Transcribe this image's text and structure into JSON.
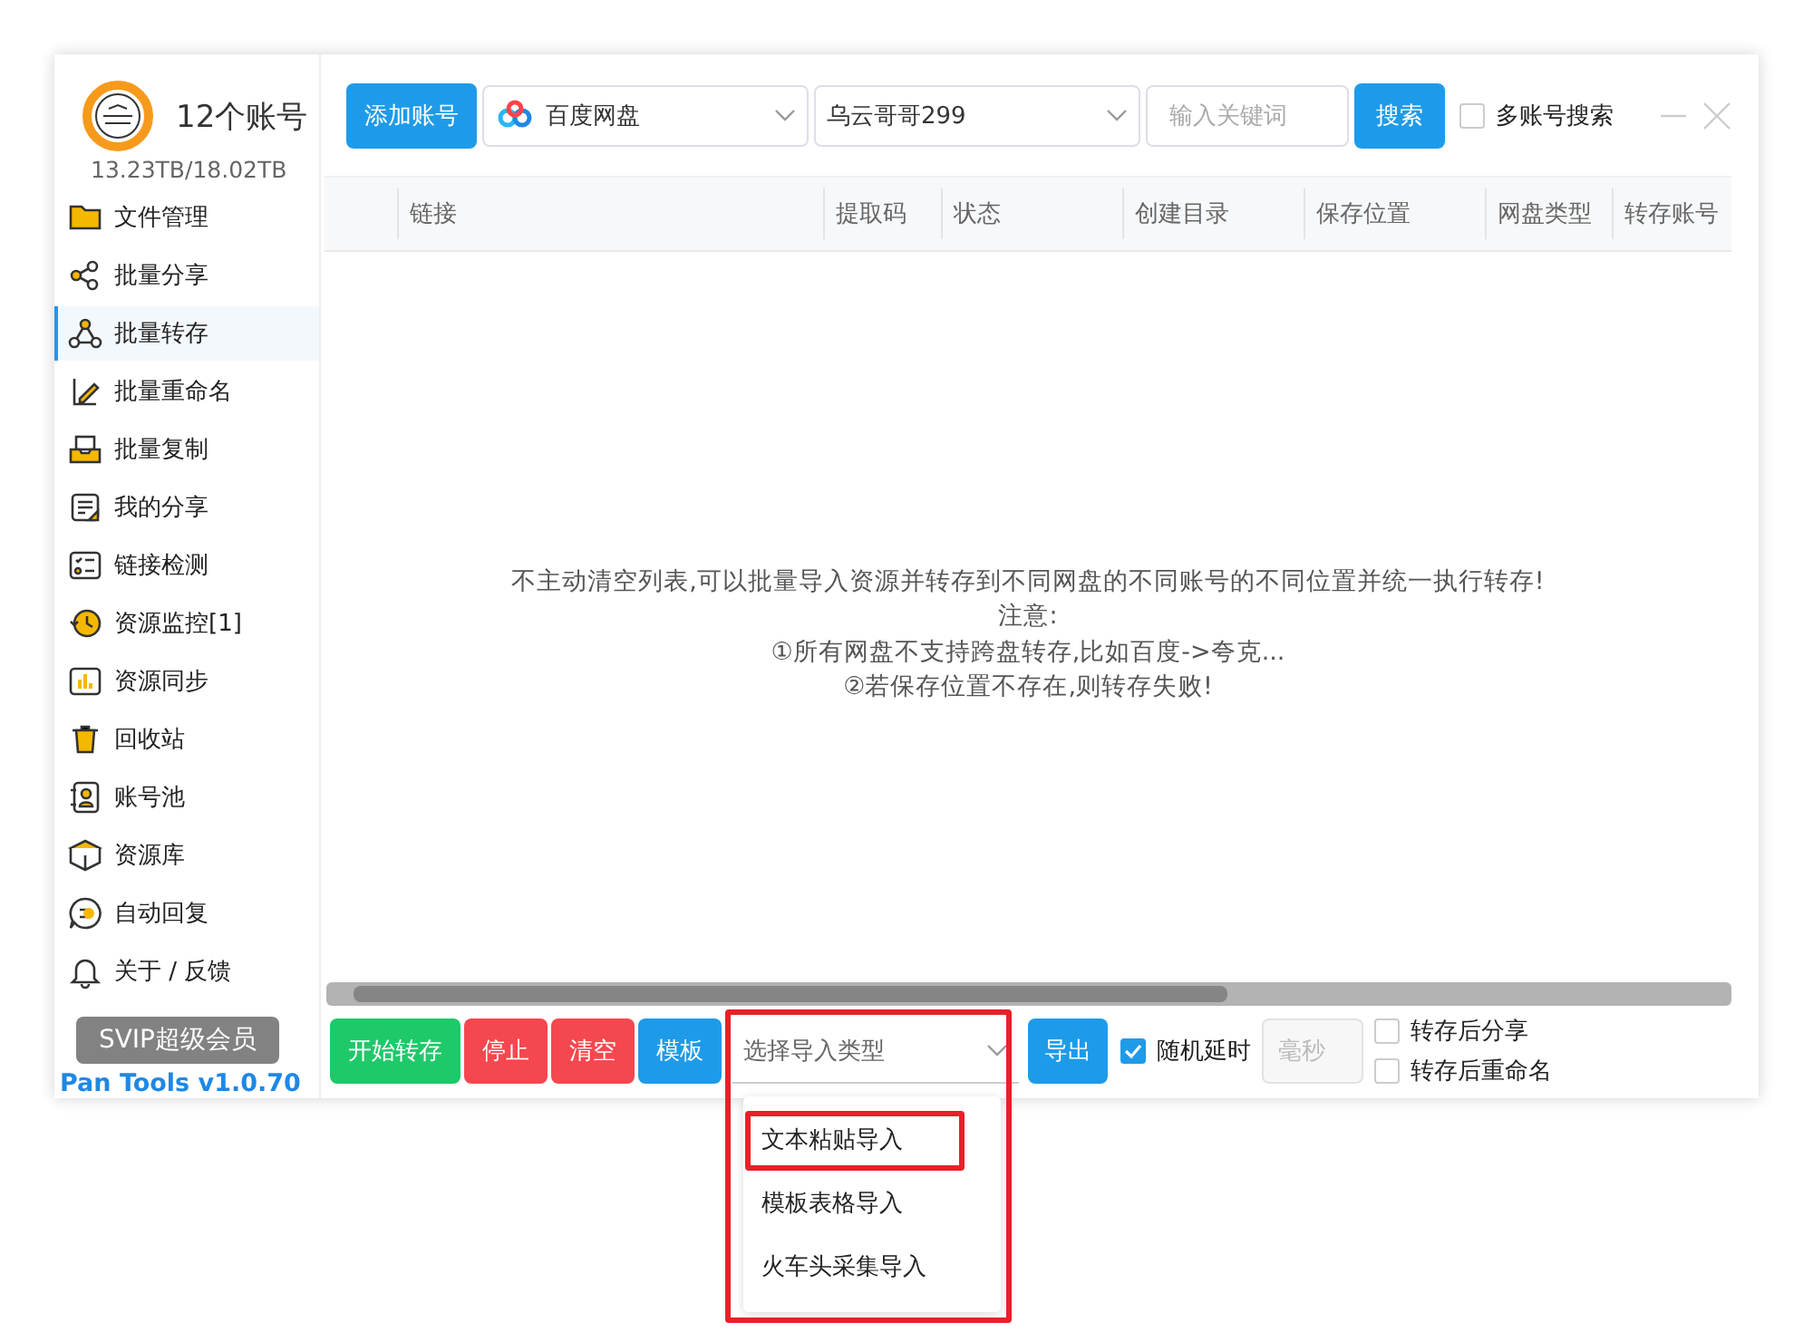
{
  "account": {
    "title": "12个账号",
    "storage": "13.23TB/18.02TB"
  },
  "sidebar": {
    "items": [
      {
        "label": "文件管理",
        "selected": false
      },
      {
        "label": "批量分享",
        "selected": false
      },
      {
        "label": "批量转存",
        "selected": true
      },
      {
        "label": "批量重命名",
        "selected": false
      },
      {
        "label": "批量复制",
        "selected": false
      },
      {
        "label": "我的分享",
        "selected": false
      },
      {
        "label": "链接检测",
        "selected": false
      },
      {
        "label": "资源监控[1]",
        "selected": false
      },
      {
        "label": "资源同步",
        "selected": false
      },
      {
        "label": "回收站",
        "selected": false
      },
      {
        "label": "账号池",
        "selected": false
      },
      {
        "label": "资源库",
        "selected": false
      },
      {
        "label": "自动回复",
        "selected": false
      },
      {
        "label": "关于 / 反馈",
        "selected": false
      }
    ],
    "vip_button": "SVIP超级会员",
    "version": "Pan Tools v1.0.70"
  },
  "toolbar": {
    "add_account": "添加账号",
    "drive_select": "百度网盘",
    "account_select": "乌云哥哥299",
    "search": {
      "placeholder": "输入关键词"
    },
    "search_button": "搜索",
    "multi_account": {
      "label": "多账号搜索",
      "checked": false
    }
  },
  "table": {
    "columns": [
      "链接",
      "提取码",
      "状态",
      "创建目录",
      "保存位置",
      "网盘类型",
      "转存账号"
    ],
    "empty_message": [
      "不主动清空列表,可以批量导入资源并转存到不同网盘的不同账号的不同位置并统一执行转存!",
      "注意:",
      "①所有网盘不支持跨盘转存,比如百度->夸克...",
      "②若保存位置不存在,则转存失败!"
    ]
  },
  "bottom_bar": {
    "buttons": [
      {
        "label": "开始转存",
        "kind": "success"
      },
      {
        "label": "停止",
        "kind": "danger"
      },
      {
        "label": "清空",
        "kind": "danger"
      },
      {
        "label": "模板",
        "kind": "primary"
      }
    ],
    "import_select": {
      "placeholder": "选择导入类型",
      "highlighted": true,
      "expanded": true,
      "options": [
        {
          "label": "文本粘贴导入",
          "highlighted": true
        },
        {
          "label": "模板表格导入",
          "highlighted": false
        },
        {
          "label": "火车头采集导入",
          "highlighted": false
        }
      ]
    },
    "export_button": "导出",
    "random_delay": {
      "label": "随机延时",
      "checked": true
    },
    "delay_field": {
      "placeholder": "毫秒"
    },
    "share_after": {
      "label": "转存后分享",
      "checked": false
    },
    "rename_after": {
      "label": "转存后重命名",
      "checked": false
    }
  }
}
